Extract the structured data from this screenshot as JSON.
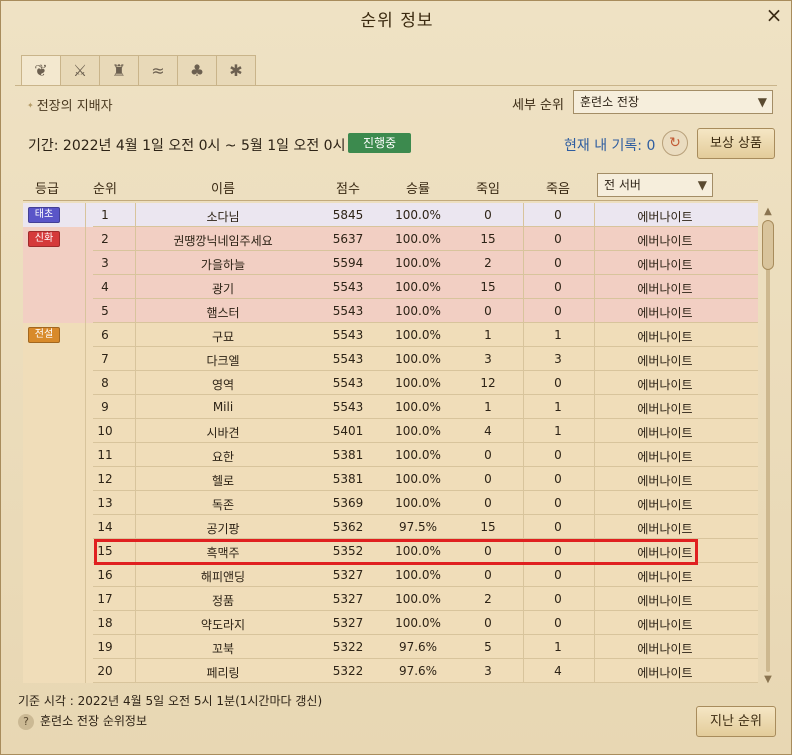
{
  "window": {
    "title": "순위 정보",
    "close_icon": "×"
  },
  "tabs": [
    {
      "icon": "wings-icon",
      "glyph": "❦"
    },
    {
      "icon": "crossed-swords-icon",
      "glyph": "⚔"
    },
    {
      "icon": "armor-icon",
      "glyph": "♜"
    },
    {
      "icon": "fish-icon",
      "glyph": "≈"
    },
    {
      "icon": "sprout-icon",
      "glyph": "♣"
    },
    {
      "icon": "butterfly-icon",
      "glyph": "✱"
    }
  ],
  "section": {
    "title": "전장의 지배자"
  },
  "sub_rank": {
    "label": "세부 순위",
    "selected": "훈련소 전장"
  },
  "period": {
    "text": "기간: 2022년 4월 1일 오전 0시  ~  5월 1일 오전 0시",
    "status": "진행중"
  },
  "my_record": {
    "text": "현재 내 기록: 0"
  },
  "buttons": {
    "reward": "보상 상품",
    "previous": "지난 순위"
  },
  "table": {
    "headers": {
      "grade": "등급",
      "rank": "순위",
      "name": "이름",
      "score": "점수",
      "winrate": "승률",
      "kills": "죽임",
      "deaths": "죽음"
    },
    "server_filter": "전 서버",
    "grades": [
      {
        "label": "태초",
        "color": "#5a55c8",
        "first_row": 0,
        "rows": 1
      },
      {
        "label": "신화",
        "color": "#d53a3a",
        "first_row": 1,
        "rows": 4
      },
      {
        "label": "전설",
        "color": "#d88a2a",
        "first_row": 5,
        "rows": 15
      }
    ],
    "rows": [
      {
        "rank": "1",
        "name": "소다님",
        "score": "5845",
        "winrate": "100.0%",
        "kills": "0",
        "deaths": "0",
        "server": "에버나이트"
      },
      {
        "rank": "2",
        "name": "권땡깡닉네임주세요",
        "score": "5637",
        "winrate": "100.0%",
        "kills": "15",
        "deaths": "0",
        "server": "에버나이트"
      },
      {
        "rank": "3",
        "name": "가을하늘",
        "score": "5594",
        "winrate": "100.0%",
        "kills": "2",
        "deaths": "0",
        "server": "에버나이트"
      },
      {
        "rank": "4",
        "name": "광기",
        "score": "5543",
        "winrate": "100.0%",
        "kills": "15",
        "deaths": "0",
        "server": "에버나이트"
      },
      {
        "rank": "5",
        "name": "햄스터",
        "score": "5543",
        "winrate": "100.0%",
        "kills": "0",
        "deaths": "0",
        "server": "에버나이트"
      },
      {
        "rank": "6",
        "name": "구묘",
        "score": "5543",
        "winrate": "100.0%",
        "kills": "1",
        "deaths": "1",
        "server": "에버나이트"
      },
      {
        "rank": "7",
        "name": "다크엘",
        "score": "5543",
        "winrate": "100.0%",
        "kills": "3",
        "deaths": "3",
        "server": "에버나이트"
      },
      {
        "rank": "8",
        "name": "영역",
        "score": "5543",
        "winrate": "100.0%",
        "kills": "12",
        "deaths": "0",
        "server": "에버나이트"
      },
      {
        "rank": "9",
        "name": "Mili",
        "score": "5543",
        "winrate": "100.0%",
        "kills": "1",
        "deaths": "1",
        "server": "에버나이트"
      },
      {
        "rank": "10",
        "name": "시바견",
        "score": "5401",
        "winrate": "100.0%",
        "kills": "4",
        "deaths": "1",
        "server": "에버나이트"
      },
      {
        "rank": "11",
        "name": "요한",
        "score": "5381",
        "winrate": "100.0%",
        "kills": "0",
        "deaths": "0",
        "server": "에버나이트"
      },
      {
        "rank": "12",
        "name": "헬로",
        "score": "5381",
        "winrate": "100.0%",
        "kills": "0",
        "deaths": "0",
        "server": "에버나이트"
      },
      {
        "rank": "13",
        "name": "독존",
        "score": "5369",
        "winrate": "100.0%",
        "kills": "0",
        "deaths": "0",
        "server": "에버나이트"
      },
      {
        "rank": "14",
        "name": "공기팡",
        "score": "5362",
        "winrate": "97.5%",
        "kills": "15",
        "deaths": "0",
        "server": "에버나이트"
      },
      {
        "rank": "15",
        "name": "흑맥주",
        "score": "5352",
        "winrate": "100.0%",
        "kills": "0",
        "deaths": "0",
        "server": "에버나이트"
      },
      {
        "rank": "16",
        "name": "해피앤딩",
        "score": "5327",
        "winrate": "100.0%",
        "kills": "0",
        "deaths": "0",
        "server": "에버나이트"
      },
      {
        "rank": "17",
        "name": "정품",
        "score": "5327",
        "winrate": "100.0%",
        "kills": "2",
        "deaths": "0",
        "server": "에버나이트"
      },
      {
        "rank": "18",
        "name": "약도라지",
        "score": "5327",
        "winrate": "100.0%",
        "kills": "0",
        "deaths": "0",
        "server": "에버나이트"
      },
      {
        "rank": "19",
        "name": "꼬북",
        "score": "5322",
        "winrate": "97.6%",
        "kills": "5",
        "deaths": "1",
        "server": "에버나이트"
      },
      {
        "rank": "20",
        "name": "페리링",
        "score": "5322",
        "winrate": "97.6%",
        "kills": "3",
        "deaths": "4",
        "server": "에버나이트"
      }
    ]
  },
  "footer": {
    "update_time": "기준 시각 : 2022년 4월 5일 오전 5시 1분(1시간마다 갱신)",
    "help_text": "훈련소 전장 순위정보",
    "help_icon": "?"
  }
}
